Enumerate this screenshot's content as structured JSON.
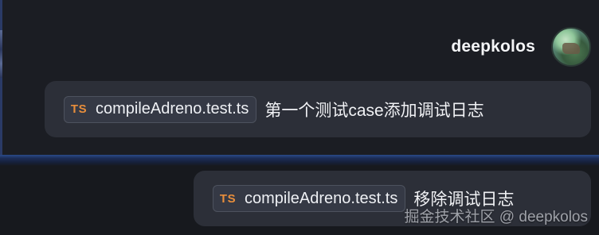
{
  "header": {
    "username": "deepkolos"
  },
  "messages": [
    {
      "file_icon": "TS",
      "file_name": "compileAdreno.test.ts",
      "text": "第一个测试case添加调试日志"
    },
    {
      "file_icon": "TS",
      "file_name": "compileAdreno.test.ts",
      "text": "移除调试日志"
    }
  ],
  "watermark": "掘金技术社区 @ deepkolos",
  "colors": {
    "background": "#17191e",
    "bubble": "#2c2f38",
    "ts_icon": "#e88e3c",
    "divider_accent": "#2a4a8a"
  }
}
